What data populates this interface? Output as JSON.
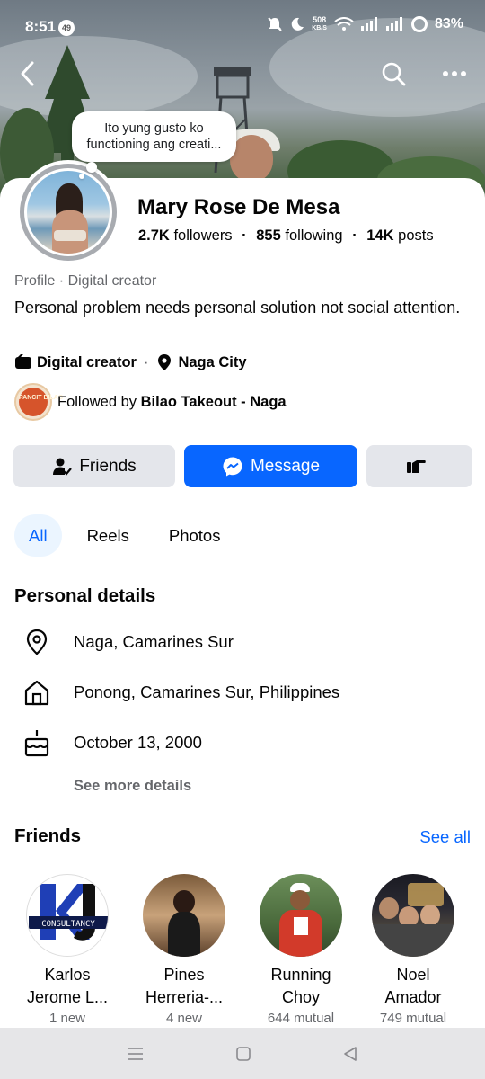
{
  "status_bar": {
    "time": "8:51",
    "notif_count": "49",
    "net_speed_value": "508",
    "net_speed_unit": "KB/S",
    "battery": "83%"
  },
  "note": {
    "text": "Ito yung gusto ko functioning ang creati..."
  },
  "profile": {
    "name": "Mary Rose De Mesa",
    "followers_count": "2.7K",
    "followers_label": "followers",
    "following_count": "855",
    "following_label": "following",
    "posts_count": "14K",
    "posts_label": "posts",
    "category": "Profile · Digital creator",
    "bio": "Personal problem needs personal solution not social attention.",
    "job": "Digital creator",
    "city": "Naga City",
    "followed_by_prefix": "Followed by",
    "followed_by_name": "Bilao Takeout - Naga",
    "page_logo_text": "PANCIT BILAO"
  },
  "actions": {
    "friends_label": "Friends",
    "message_label": "Message"
  },
  "tabs": [
    {
      "label": "All",
      "active": true
    },
    {
      "label": "Reels",
      "active": false
    },
    {
      "label": "Photos",
      "active": false
    }
  ],
  "personal_details": {
    "title": "Personal details",
    "items": [
      {
        "icon": "location-pin-icon",
        "text": "Naga, Camarines Sur"
      },
      {
        "icon": "home-icon",
        "text": "Ponong, Camarines Sur, Philippines"
      },
      {
        "icon": "birthday-cake-icon",
        "text": "October 13, 2000"
      }
    ],
    "see_more": "See more details"
  },
  "friends": {
    "title": "Friends",
    "see_all": "See all",
    "list": [
      {
        "name_line1": "Karlos",
        "name_line2": "Jerome L...",
        "meta": "1 new"
      },
      {
        "name_line1": "Pines",
        "name_line2": "Herreria-...",
        "meta": "4 new"
      },
      {
        "name_line1": "Running",
        "name_line2": "Choy",
        "meta": "644 mutual"
      },
      {
        "name_line1": "Noel",
        "name_line2": "Amador",
        "meta": "749 mutual"
      }
    ],
    "karlos_logo_text": "CONSULTANCY"
  },
  "colors": {
    "accent": "#0866ff",
    "button_gray": "#e4e6eb",
    "secondary_text": "#65676b",
    "tab_active_bg": "#ebf5ff"
  }
}
